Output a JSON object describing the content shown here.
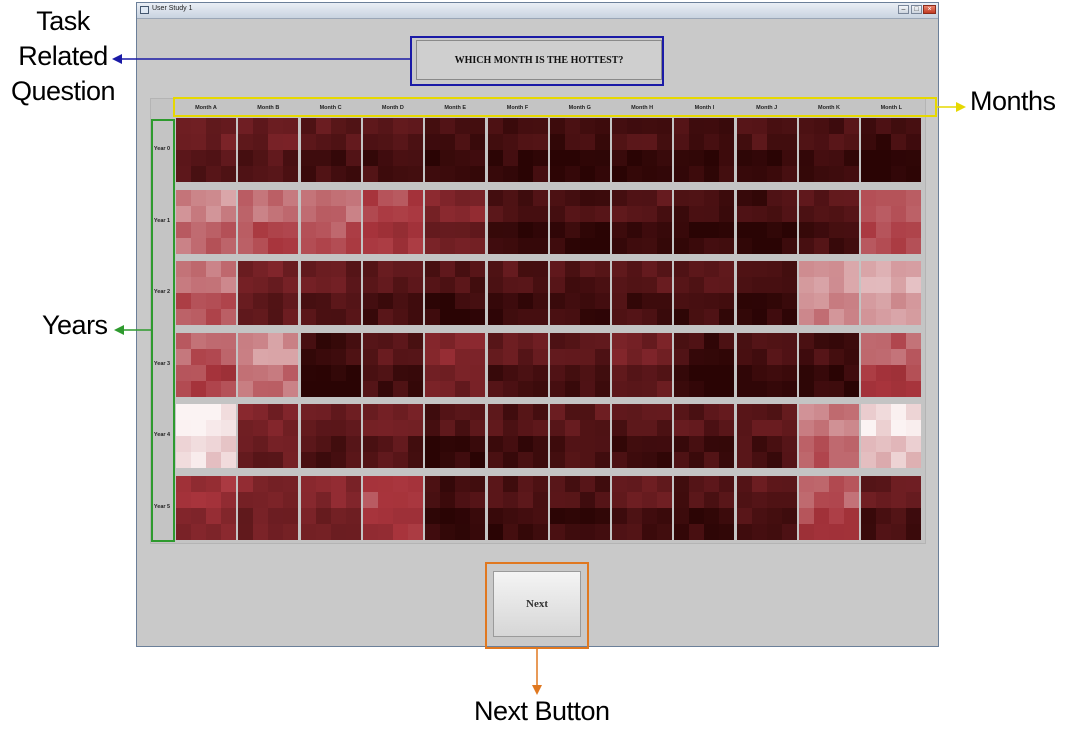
{
  "window": {
    "title": "User Study 1"
  },
  "question": "WHICH MONTH IS THE HOTTEST?",
  "months": [
    "Month A",
    "Month B",
    "Month C",
    "Month D",
    "Month E",
    "Month F",
    "Month G",
    "Month H",
    "Month I",
    "Month J",
    "Month K",
    "Month L"
  ],
  "years": [
    "Year 0",
    "Year 1",
    "Year 2",
    "Year 3",
    "Year 4",
    "Year 5"
  ],
  "heat_levels": [
    [
      0.22,
      0.2,
      0.14,
      0.14,
      0.06,
      0.08,
      0.03,
      0.1,
      0.08,
      0.1,
      0.08,
      0.02
    ],
    [
      0.68,
      0.6,
      0.62,
      0.5,
      0.3,
      0.08,
      0.07,
      0.12,
      0.08,
      0.05,
      0.15,
      0.58
    ],
    [
      0.62,
      0.26,
      0.18,
      0.16,
      0.1,
      0.12,
      0.1,
      0.14,
      0.12,
      0.1,
      0.74,
      0.78
    ],
    [
      0.56,
      0.7,
      0.04,
      0.14,
      0.32,
      0.16,
      0.14,
      0.24,
      0.04,
      0.1,
      0.06,
      0.56
    ],
    [
      0.96,
      0.28,
      0.18,
      0.2,
      0.1,
      0.1,
      0.16,
      0.12,
      0.14,
      0.16,
      0.64,
      0.9
    ],
    [
      0.42,
      0.3,
      0.3,
      0.5,
      0.06,
      0.1,
      0.1,
      0.16,
      0.1,
      0.16,
      0.56,
      0.16
    ]
  ],
  "next_label": "Next",
  "annotations": {
    "task_label": "Task\nRelated\nQuestion",
    "months_label": "Months",
    "years_label": "Years",
    "next_label": "Next Button"
  },
  "colors": {
    "task": "#1a1aa6",
    "months": "#e6d800",
    "years": "#2e9a2e",
    "next": "#e07820",
    "heat_dark": "#2a0404",
    "heat_mid": "#a8343c",
    "heat_light": "#fbf3f3"
  }
}
